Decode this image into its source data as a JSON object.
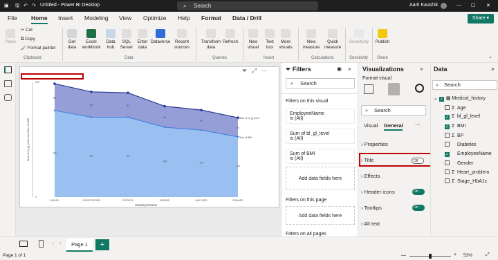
{
  "titlebar": {
    "file_name": "Untitled - Power BI Desktop",
    "search_placeholder": "Search",
    "user": "Aarti Kaushik"
  },
  "menu": {
    "tabs": [
      "File",
      "Home",
      "Insert",
      "Modeling",
      "View",
      "Optimize",
      "Help",
      "Format",
      "Data / Drill"
    ],
    "share": "Share"
  },
  "ribbon": {
    "clipboard": {
      "paste": "Paste",
      "cut": "Cut",
      "copy": "Copy",
      "format_painter": "Format painter",
      "group": "Clipboard"
    },
    "data": {
      "get_data": "Get data",
      "excel": "Excel workbook",
      "hub": "Data hub",
      "sql": "SQL Server",
      "enter": "Enter data",
      "dataverse": "Dataverse",
      "recent": "Recent sources",
      "group": "Data"
    },
    "queries": {
      "transform": "Transform data",
      "refresh": "Refresh",
      "group": "Queries"
    },
    "insert": {
      "new_visual": "New visual",
      "text_box": "Text box",
      "more_visuals": "More visuals",
      "group": "Insert"
    },
    "calc": {
      "new_measure": "New measure",
      "quick_measure": "Quick measure",
      "group": "Calculations"
    },
    "sensitivity": {
      "label": "Sensitivity",
      "group": "Sensitivity"
    },
    "share": {
      "publish": "Publish",
      "group": "Share"
    }
  },
  "filters": {
    "title": "Filters",
    "search": "Search",
    "on_visual": "Filters on this visual",
    "cards": [
      {
        "name": "EmployeeName",
        "state": "is (All)"
      },
      {
        "name": "Sum of bl_gl_level",
        "state": "is (All)"
      },
      {
        "name": "Sum of BMI",
        "state": "is (All)"
      }
    ],
    "add_fields": "Add data fields here",
    "on_page": "Filters on this page",
    "on_all_pages": "Filters on all pages"
  },
  "viz": {
    "title": "Visualizations",
    "format_visual": "Format visual",
    "search": "Search",
    "tabs": [
      "Visual",
      "General"
    ],
    "sections": [
      "Properties",
      "Title",
      "Effects",
      "Header icons",
      "Tooltips",
      "Alt text"
    ],
    "title_toggle": "Off",
    "header_toggle": "On",
    "tooltips_toggle": "On"
  },
  "data_panel": {
    "title": "Data",
    "search": "Search",
    "table": "Medical_history",
    "fields": [
      {
        "name": "Age",
        "sigma": true,
        "checked": false
      },
      {
        "name": "bl_gl_level",
        "sigma": true,
        "checked": true
      },
      {
        "name": "BMI",
        "sigma": true,
        "checked": true
      },
      {
        "name": "BP",
        "sigma": true,
        "checked": false
      },
      {
        "name": "Diabetes",
        "sigma": false,
        "checked": false
      },
      {
        "name": "EmployeeName",
        "sigma": false,
        "checked": true
      },
      {
        "name": "Gender",
        "sigma": false,
        "checked": false
      },
      {
        "name": "Heart_problem",
        "sigma": true,
        "checked": false
      },
      {
        "name": "Stage_HbA1c",
        "sigma": true,
        "checked": false
      }
    ]
  },
  "page": {
    "tab": "Page 1",
    "status": "Page 1 of 1",
    "zoom": "53%"
  },
  "chart_data": {
    "type": "area",
    "categories": [
      "MONEY",
      "CHRISTOPHER",
      "PATRICIA",
      "MORRIS",
      "WALFORD",
      "EDWARD"
    ],
    "series": [
      {
        "name": "Sum of BMI",
        "values": [
          181,
          167,
          167,
          146,
          140,
          126
        ],
        "color": "#8fb8f0"
      },
      {
        "name": "Sum of bl_gl_level",
        "values": [
          56,
          53,
          51,
          44,
          42,
          40
        ],
        "color": "#8a93d1"
      }
    ],
    "point_labels": [
      "56",
      "53",
      "51",
      "44",
      "42",
      "40"
    ],
    "xlabel": "EmployeeName",
    "ylabel": "Sum of bl_gl_level and Sum of BMI",
    "ylim": [
      0,
      240
    ],
    "y_ticks": [
      "0",
      "240"
    ]
  },
  "colors": {
    "accent": "#117865",
    "highlight": "#c00000",
    "line": "#2a3a96"
  }
}
